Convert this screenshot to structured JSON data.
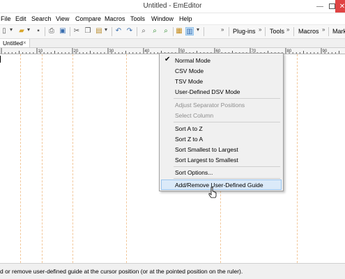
{
  "window": {
    "title": "Untitled - EmEditor"
  },
  "menubar": {
    "items": [
      "File",
      "Edit",
      "Search",
      "View",
      "Compare",
      "Macros",
      "Tools",
      "Window",
      "Help"
    ]
  },
  "toolbar": {
    "groups": [
      "Plug-ins",
      "Tools",
      "Macros",
      "Mark"
    ]
  },
  "tabs": [
    {
      "label": "Untitled",
      "close": "×"
    }
  ],
  "ruler": {
    "labels": [
      "10",
      "20",
      "30",
      "40",
      "50",
      "60",
      "70",
      "80",
      "90"
    ]
  },
  "context_menu": {
    "items": [
      {
        "label": "Normal Mode",
        "checked": true
      },
      {
        "label": "CSV Mode"
      },
      {
        "label": "TSV Mode"
      },
      {
        "label": "User-Defined DSV Mode"
      },
      {
        "label": "Adjust Separator Positions",
        "disabled": true
      },
      {
        "label": "Select Column",
        "disabled": true
      },
      {
        "label": "Sort A to Z"
      },
      {
        "label": "Sort Z to A"
      },
      {
        "label": "Sort Smallest to Largest"
      },
      {
        "label": "Sort Largest to Smallest"
      },
      {
        "label": "Sort Options..."
      },
      {
        "label": "Add/Remove User-Defined Guide",
        "highlighted": true
      }
    ]
  },
  "statusbar": {
    "text": "d or remove user-defined guide at the cursor position (or at the pointed position on the ruler)."
  },
  "colors": {
    "guide": "#f2c79a",
    "highlight": "#dbeaf9",
    "close": "#e04343"
  }
}
